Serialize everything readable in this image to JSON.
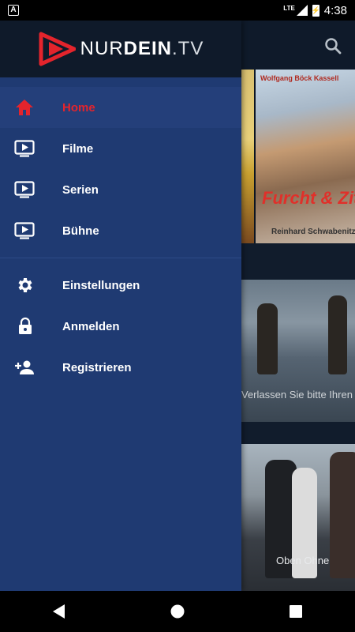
{
  "status": {
    "time": "4:38",
    "network": "LTE",
    "battery_glyph": "⚡",
    "app_badge": "A"
  },
  "brand": {
    "part1": "NUR",
    "part2": "DEIN",
    "part3": ".TV",
    "logo_color": "#e4242c"
  },
  "menu": {
    "primary": [
      {
        "label": "Home",
        "icon": "home-icon",
        "active": true
      },
      {
        "label": "Filme",
        "icon": "tv-play-icon"
      },
      {
        "label": "Serien",
        "icon": "tv-play-icon"
      },
      {
        "label": "Bühne",
        "icon": "tv-play-icon"
      }
    ],
    "secondary": [
      {
        "label": "Einstellungen",
        "icon": "gear-icon"
      },
      {
        "label": "Anmelden",
        "icon": "lock-icon"
      },
      {
        "label": "Registrieren",
        "icon": "add-user-icon"
      }
    ]
  },
  "content": {
    "poster2_top": "Wolfgang Böck Kassell",
    "poster2_title": "Furcht & Zittern",
    "poster2_credit": "Reinhard Schwabenitzky",
    "beach_caption": "Verlassen Sie bitte Ihren M",
    "people_caption": "Oben Ohne"
  },
  "colors": {
    "accent": "#e4242c",
    "drawer": "#1f3a72",
    "header": "#0f1a2a"
  }
}
